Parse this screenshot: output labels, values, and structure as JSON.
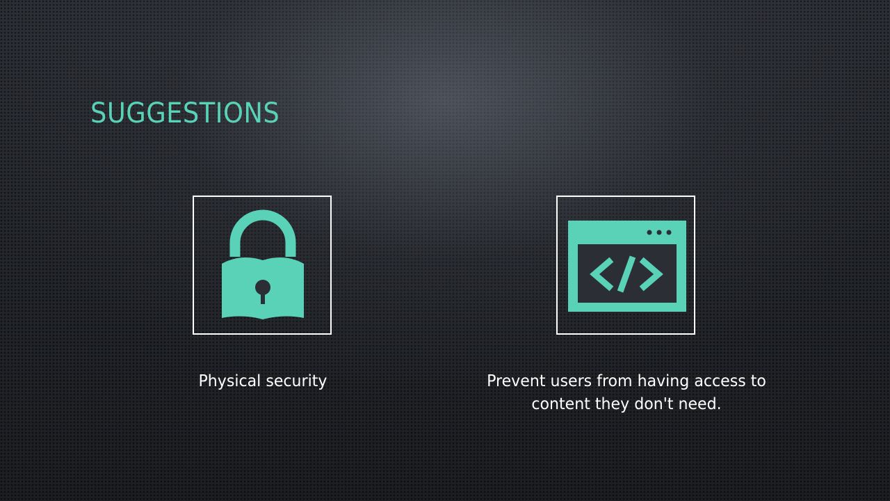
{
  "slide": {
    "title": "SUGGESTIONS",
    "accent_color": "#59d2b8",
    "background_color": "#2b2e34",
    "items": [
      {
        "icon": "padlock-icon",
        "caption": "Physical security"
      },
      {
        "icon": "code-window-icon",
        "caption": "Prevent users from having access to content they don't need."
      }
    ]
  }
}
